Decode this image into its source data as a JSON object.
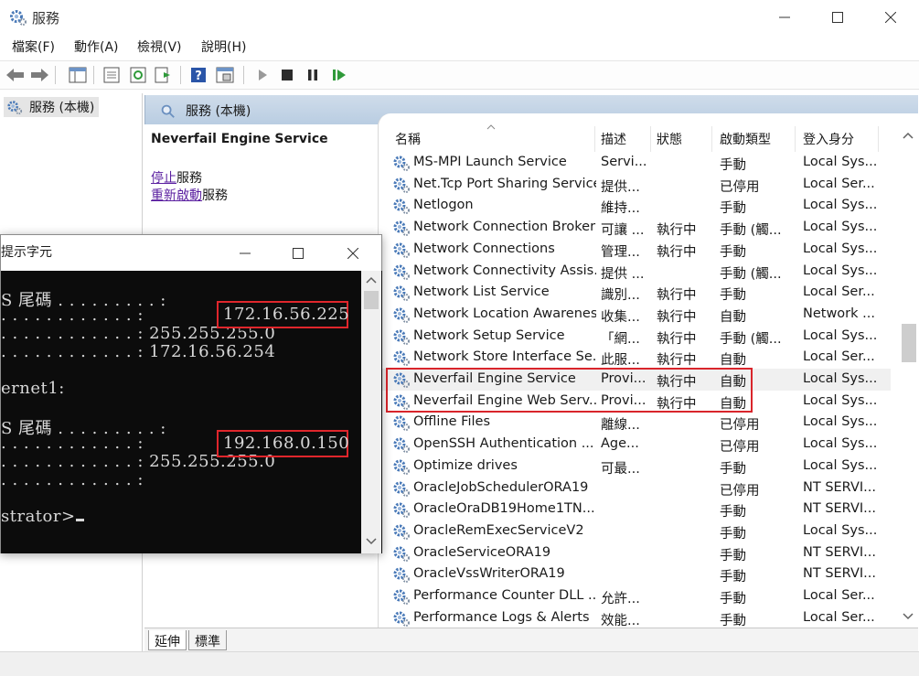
{
  "window": {
    "title": "服務",
    "icon": "gear-icon"
  },
  "menu": [
    "檔案(F)",
    "動作(A)",
    "檢視(V)",
    "說明(H)"
  ],
  "toolbar": {
    "icons": [
      "back-arrow-icon",
      "forward-arrow-icon",
      "show-tree-icon",
      "properties-icon",
      "refresh-icon",
      "export-icon",
      "help-icon",
      "view-icon",
      "play-icon",
      "stop-icon",
      "pause-icon",
      "resume-icon"
    ]
  },
  "tree": {
    "label": "服務 (本機)"
  },
  "right_header": {
    "label": "服務 (本機)"
  },
  "desc": {
    "title": "Neverfail Engine Service",
    "stop_link": "停止",
    "stop_suffix": "服務",
    "restart_link": "重新啟動",
    "restart_suffix": "服務"
  },
  "columns": [
    "名稱",
    "描述",
    "狀態",
    "啟動類型",
    "登入身分"
  ],
  "rows": [
    [
      "MS-MPI Launch Service",
      "Servi...",
      "",
      "手動",
      "Local Sys..."
    ],
    [
      "Net.Tcp Port Sharing Service",
      "提供...",
      "",
      "已停用",
      "Local Ser..."
    ],
    [
      "Netlogon",
      "維持...",
      "",
      "手動",
      "Local Sys..."
    ],
    [
      "Network Connection Broker",
      "可讓 ...",
      "執行中",
      "手動 (觸...",
      "Local Sys..."
    ],
    [
      "Network Connections",
      "管理...",
      "執行中",
      "手動",
      "Local Sys..."
    ],
    [
      "Network Connectivity Assis...",
      "提供 ...",
      "",
      "手動 (觸...",
      "Local Sys..."
    ],
    [
      "Network List Service",
      "識別...",
      "執行中",
      "手動",
      "Local Ser..."
    ],
    [
      "Network Location Awareness",
      "收集...",
      "執行中",
      "自動",
      "Network ..."
    ],
    [
      "Network Setup Service",
      "「網...",
      "執行中",
      "手動 (觸...",
      "Local Sys..."
    ],
    [
      "Network Store Interface Se...",
      "此服...",
      "執行中",
      "自動",
      "Local Ser..."
    ],
    [
      "Neverfail Engine Service",
      "Provi...",
      "執行中",
      "自動",
      "Local Sys..."
    ],
    [
      "Neverfail Engine Web Serv...",
      "Provi...",
      "執行中",
      "自動",
      "Local Sys..."
    ],
    [
      "Offline Files",
      "離線...",
      "",
      "已停用",
      "Local Sys..."
    ],
    [
      "OpenSSH Authentication ...",
      "Age...",
      "",
      "已停用",
      "Local Sys..."
    ],
    [
      "Optimize drives",
      "可最...",
      "",
      "手動",
      "Local Sys..."
    ],
    [
      "OracleJobSchedulerORA19",
      "",
      "",
      "已停用",
      "NT SERVI..."
    ],
    [
      "OracleOraDB19Home1TN...",
      "",
      "",
      "手動",
      "NT SERVI..."
    ],
    [
      "OracleRemExecServiceV2",
      "",
      "",
      "手動",
      "Local Sys..."
    ],
    [
      "OracleServiceORA19",
      "",
      "",
      "手動",
      "NT SERVI..."
    ],
    [
      "OracleVssWriterORA19",
      "",
      "",
      "手動",
      "NT SERVI..."
    ],
    [
      "Performance Counter DLL ...",
      "允許...",
      "",
      "手動",
      "Local Ser..."
    ],
    [
      "Performance Logs & Alerts",
      "效能...",
      "",
      "手動",
      "Local Ser..."
    ]
  ],
  "tabs": [
    "延伸",
    "標準"
  ],
  "cmd": {
    "title": "提示字元",
    "lines": [
      "S 尾碼 . . . . . . . . . :",
      ". . . . . . . . . . . . :",
      ". . . . . . . . . . . . : 255.255.255.0",
      ". . . . . . . . . . . . : 172.16.56.254",
      "",
      "ernet1:",
      "",
      "S 尾碼 . . . . . . . . . :",
      ". . . . . . . . . . . . :",
      ". . . . . . . . . . . . : 255.255.255.0",
      ". . . . . . . . . . . . :",
      "",
      "strator>"
    ],
    "ip1": "172.16.56.225",
    "ip2": "192.168.0.150"
  }
}
